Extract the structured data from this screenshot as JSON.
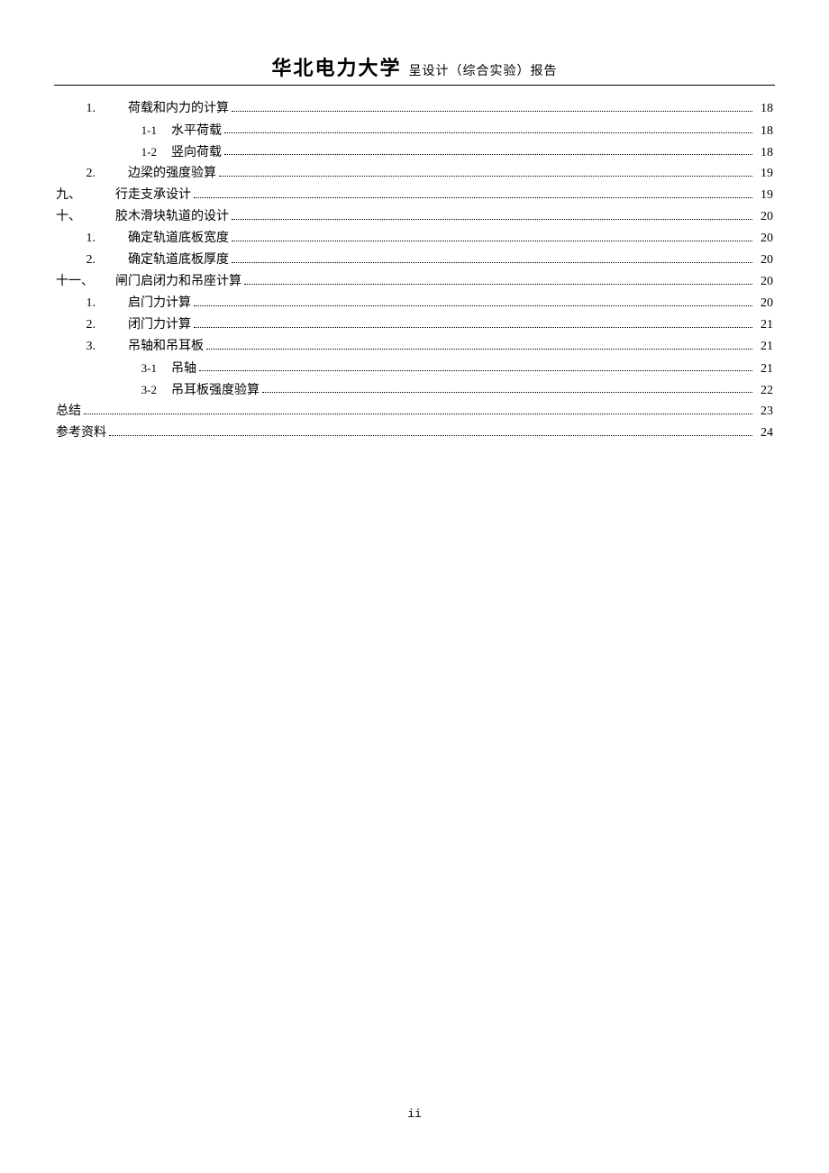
{
  "header": {
    "university": "华北电力大学",
    "title": "呈设计（综合实验）报告"
  },
  "toc": [
    {
      "level": "a",
      "num": "1.",
      "label": "荷载和内力的计算",
      "page": "18"
    },
    {
      "level": "b",
      "num": "1-1",
      "label": "水平荷载",
      "page": "18"
    },
    {
      "level": "b",
      "num": "1-2",
      "label": "竖向荷载",
      "page": "18"
    },
    {
      "level": "a",
      "num": "2.",
      "label": "边梁的强度验算",
      "page": "19"
    },
    {
      "level": "top",
      "num": "九、",
      "label": "行走支承设计",
      "page": "19"
    },
    {
      "level": "top",
      "num": "十、",
      "label": "胶木滑块轨道的设计",
      "page": "20"
    },
    {
      "level": "a",
      "num": "1.",
      "label": "确定轨道底板宽度",
      "page": "20"
    },
    {
      "level": "a",
      "num": "2.",
      "label": "确定轨道底板厚度",
      "page": "20"
    },
    {
      "level": "top",
      "num": "十一、",
      "label": "闸门启闭力和吊座计算",
      "page": "20"
    },
    {
      "level": "a",
      "num": "1.",
      "label": "启门力计算",
      "page": "20"
    },
    {
      "level": "a",
      "num": "2.",
      "label": "闭门力计算",
      "page": "21"
    },
    {
      "level": "a",
      "num": "3.",
      "label": "吊轴和吊耳板",
      "page": "21"
    },
    {
      "level": "b",
      "num": "3-1",
      "label": "吊轴",
      "page": "21"
    },
    {
      "level": "b",
      "num": "3-2",
      "label": "吊耳板强度验算",
      "page": "22"
    },
    {
      "level": "root",
      "num": "",
      "label": "总结",
      "page": "23"
    },
    {
      "level": "root",
      "num": "",
      "label": "参考资料",
      "page": "24"
    }
  ],
  "footer": {
    "page_number": "ii"
  }
}
